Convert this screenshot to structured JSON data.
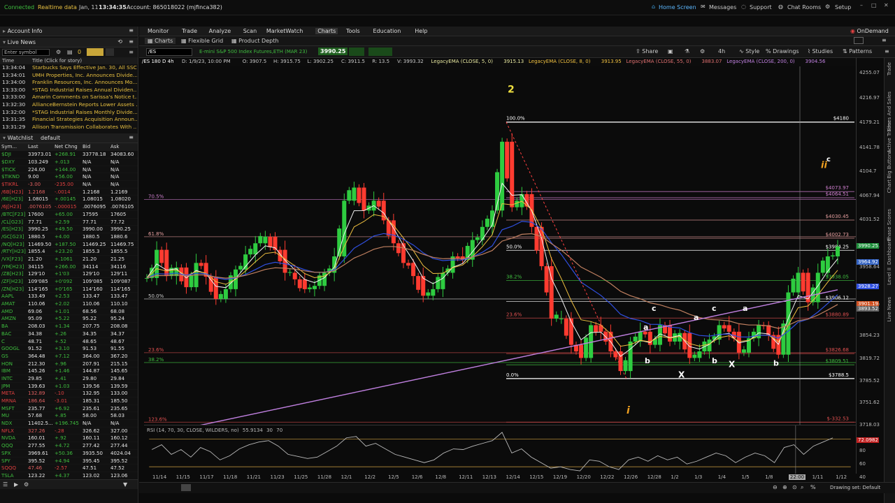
{
  "status": {
    "connected": "Connected",
    "realtime": "Realtime data",
    "date": "Jan, 11",
    "time": "13:34:35",
    "account": "Account: 865018022 (mjfinca382)",
    "home": "Home Screen",
    "messages": "Messages",
    "support": "Support",
    "chat": "Chat Rooms",
    "setup": "Setup"
  },
  "left": {
    "account_info": "Account Info",
    "live_news": "Live News",
    "enter_symbol": "Enter symbol",
    "count": "0",
    "news_header_time": "Time",
    "news_header_title": "Title (Click for story)",
    "news": [
      {
        "time": "13:34:04",
        "title": "Starbucks Says Effective Jan. 30, All SSC ..."
      },
      {
        "time": "13:34:01",
        "title": "UMH Properties, Inc. Announces Divide..."
      },
      {
        "time": "13:34:00",
        "title": "Franklin Resources, Inc. Announces Mo..."
      },
      {
        "time": "13:33:00",
        "title": "*STAG Industrial Raises Annual Dividen..."
      },
      {
        "time": "13:33:00",
        "title": "Amarin Comments on Sarissa's Notice t..."
      },
      {
        "time": "13:32:30",
        "title": "AllianceBernstein Reports Lower Assets ..."
      },
      {
        "time": "13:32:00",
        "title": "*STAG Industrial Raises Monthly Divide..."
      },
      {
        "time": "13:31:35",
        "title": "Financial Strategies Acquisition Announ..."
      },
      {
        "time": "13:31:29",
        "title": "Allison Transmission Collaborates With ..."
      }
    ],
    "watchlist_label": "Watchlist",
    "watchlist_name": "default",
    "cols": [
      "Sym...",
      "Last",
      "Net Chng",
      "Bid",
      "Ask"
    ],
    "rows": [
      [
        "$DJI",
        "33973.01",
        "+268.91",
        "33778.18",
        "34083.60"
      ],
      [
        "$DXY",
        "103.249",
        "+.013",
        "N/A",
        "N/A"
      ],
      [
        "$TICK",
        "224.00",
        "+144.00",
        "N/A",
        "N/A"
      ],
      [
        "$TIKND",
        "9.00",
        "+56.00",
        "N/A",
        "N/A"
      ],
      [
        "$TIKRL",
        "-3.00",
        "-235.00",
        "N/A",
        "N/A"
      ],
      [
        "/6B[H23]",
        "1.2168",
        "-.0014",
        "1.2168",
        "1.2169"
      ],
      [
        "/6E[H23]",
        "1.08015",
        "+.00145",
        "1.08015",
        "1.08020"
      ],
      [
        "/6J[H23]",
        ".0076105",
        "-.000015",
        ".0076095",
        ".0076105"
      ],
      [
        "/BTC[F23]",
        "17600",
        "+65.00",
        "17595",
        "17605"
      ],
      [
        "/CL[G23]",
        "77.71",
        "+2.59",
        "77.71",
        "77.72"
      ],
      [
        "/ES[H23]",
        "3990.25",
        "+49.50",
        "3990.00",
        "3990.25"
      ],
      [
        "/GC[G23]",
        "1880.5",
        "+4.00",
        "1880.5",
        "1880.6"
      ],
      [
        "/NQ[H23]",
        "11469.50",
        "+187.50",
        "11469.25",
        "11469.75"
      ],
      [
        "/RTY[H23]",
        "1855.4",
        "+23.20",
        "1855.3",
        "1855.5"
      ],
      [
        "/VX[F23]",
        "21.20",
        "+.1061",
        "21.20",
        "21.25"
      ],
      [
        "/YM[H23]",
        "34115",
        "+266.00",
        "34114",
        "34116"
      ],
      [
        "/ZB[H23]",
        "129'10",
        "+1'03",
        "129'10",
        "129'11"
      ],
      [
        "/ZF[H23]",
        "109'085",
        "+0'092",
        "109'085",
        "109'087"
      ],
      [
        "/ZN[H23]",
        "114'165",
        "+0'165",
        "114'160",
        "114'165"
      ],
      [
        "AAPL",
        "133.49",
        "+2.53",
        "133.47",
        "133.47"
      ],
      [
        "AMAT",
        "110.06",
        "+2.02",
        "110.06",
        "110.10"
      ],
      [
        "AMD",
        "69.06",
        "+1.01",
        "68.56",
        "68.08"
      ],
      [
        "AMZN",
        "95.09",
        "+5.22",
        "95.22",
        "95.24"
      ],
      [
        "BA",
        "208.03",
        "+1.34",
        "207.75",
        "208.08"
      ],
      [
        "BAC",
        "34.38",
        "+.26",
        "34.35",
        "34.37"
      ],
      [
        "C",
        "48.71",
        "+.52",
        "48.65",
        "48.67"
      ],
      [
        "GOOGL",
        "91.52",
        "+3.10",
        "91.53",
        "91.55"
      ],
      [
        "GS",
        "364.48",
        "+7.12",
        "364.00",
        "367.20"
      ],
      [
        "HON",
        "212.30",
        "+.96",
        "207.91",
        "215.15"
      ],
      [
        "IBM",
        "145.26",
        "+1.46",
        "144.87",
        "145.65"
      ],
      [
        "INTC",
        "29.85",
        "+.41",
        "29.80",
        "29.84"
      ],
      [
        "JPM",
        "139.63",
        "+1.03",
        "139.56",
        "139.59"
      ],
      [
        "META",
        "132.89",
        "-.10",
        "132.95",
        "133.00"
      ],
      [
        "MRNA",
        "186.64",
        "-3.01",
        "185.31",
        "185.50"
      ],
      [
        "MSFT",
        "235.77",
        "+6.92",
        "235.61",
        "235.65"
      ],
      [
        "MU",
        "57.68",
        "+.85",
        "58.00",
        "58.03"
      ],
      [
        "NDX",
        "11402.5...",
        "+196.745",
        "N/A",
        "N/A"
      ],
      [
        "NFLX",
        "327.26",
        "-.28",
        "326.62",
        "327.00"
      ],
      [
        "NVDA",
        "160.01",
        "+.92",
        "160.11",
        "160.12"
      ],
      [
        "QQQ",
        "277.55",
        "+4.72",
        "277.42",
        "277.44"
      ],
      [
        "SPX",
        "3969.61",
        "+50.36",
        "3935.50",
        "4024.04"
      ],
      [
        "SPY",
        "395.52",
        "+4.94",
        "395.45",
        "395.52"
      ],
      [
        "SQQQ",
        "47.46",
        "-2.57",
        "47.51",
        "47.52"
      ],
      [
        "TSLA",
        "123.22",
        "+4.37",
        "123.02",
        "123.06"
      ]
    ]
  },
  "menu": [
    "Monitor",
    "Trade",
    "Analyze",
    "Scan",
    "MarketWatch",
    "Charts",
    "Tools",
    "Education",
    "Help"
  ],
  "ondemand": "OnDemand",
  "subtabs": [
    "Charts",
    "Flexible Grid",
    "Product Depth"
  ],
  "chartbar": {
    "symbol": "/ES",
    "desc": "E-mini S&P 500 Index Futures,ETH (MAR 23)",
    "price": "3990.25",
    "tools": [
      "Share",
      "4h",
      "Style",
      "Drawings",
      "Studies",
      "Patterns"
    ]
  },
  "studybar": [
    {
      "text": "/ES 180 D 4h",
      "color": "#ffffff"
    },
    {
      "text": "D: 1/9/23, 10:00 PM",
      "color": "#c8c8c8"
    },
    {
      "text": "O: 3907.5",
      "color": "#c8c8c8"
    },
    {
      "text": "H: 3915.75",
      "color": "#c8c8c8"
    },
    {
      "text": "L: 3902.25",
      "color": "#c8c8c8"
    },
    {
      "text": "C: 3911.5",
      "color": "#c8c8c8"
    },
    {
      "text": "R: 13.5",
      "color": "#c8c8c8"
    },
    {
      "text": "V: 3993.32",
      "color": "#c8c8c8"
    },
    {
      "text": "LegacyEMA (CLOSE, 5, 0)",
      "color": "#e8e8a0"
    },
    {
      "text": "3915.13",
      "color": "#e8e8a0"
    },
    {
      "text": "LegacyEMA (CLOSE, 8, 0)",
      "color": "#f0c040"
    },
    {
      "text": "3913.95",
      "color": "#f0c040"
    },
    {
      "text": "LegacyEMA (CLOSE, 55, 0)",
      "color": "#e07070"
    },
    {
      "text": "3883.07",
      "color": "#e07070"
    },
    {
      "text": "LegacyEMA (CLOSE, 200, 0)",
      "color": "#c080e0"
    },
    {
      "text": "3904.56",
      "color": "#c080e0"
    }
  ],
  "chart_data": {
    "type": "candlestick",
    "symbol": "/ES",
    "ylim": [
      3718.03,
      4265
    ],
    "price_ticks": [
      "4255.07",
      "4216.97",
      "4179.21",
      "4141.78",
      "4104.7",
      "4067.94",
      "4031.52",
      "3990.25",
      "3958.64",
      "3928.27",
      "3901.19",
      "3893.52",
      "3854.23",
      "3819.72",
      "3785.52",
      "3751.62",
      "3718.03"
    ],
    "date_ticks": [
      "11/14",
      "11/15",
      "11/17",
      "11/18",
      "11/21",
      "11/23",
      "11/25",
      "11/28",
      "12/1",
      "12/2",
      "12/5",
      "12/6",
      "12/8",
      "12/11",
      "12/13",
      "12/14",
      "12/15",
      "12/19",
      "12/20",
      "12/22",
      "12/26",
      "12/28",
      "1/2",
      "1/3",
      "1/4",
      "1/5",
      "1/8",
      "22:00",
      "1/11",
      "1/12"
    ],
    "close_path": [
      3942,
      3985,
      3945,
      3958,
      3928,
      3965,
      3944,
      3910,
      3925,
      3955,
      3978,
      3995,
      4005,
      3985,
      3950,
      3940,
      3925,
      3930,
      3950,
      3975,
      4060,
      4080,
      4045,
      4060,
      4030,
      3995,
      3965,
      3945,
      3915,
      3925,
      3950,
      3975,
      3970,
      4000,
      4020,
      4045,
      4150,
      4050,
      4070,
      4020,
      3960,
      3880,
      3880,
      3840,
      3820,
      3870,
      3860,
      3830,
      3800,
      3845,
      3860,
      3840,
      3870,
      3845,
      3858,
      3820,
      3830,
      3848,
      3870,
      3860,
      3828,
      3850,
      3870,
      3855,
      3825,
      3920,
      3950,
      3905,
      3950,
      3975,
      3990
    ],
    "fib_left": [
      {
        "label": "70.5%",
        "price": 4062
      },
      {
        "label": "61.8%",
        "price": 4005
      },
      {
        "label": "50.0%",
        "price": 3910
      },
      {
        "label": "23.6%",
        "price": 3828
      },
      {
        "label": "38.2%",
        "price": 3813
      },
      {
        "label": "123.6%",
        "price": 3722
      }
    ],
    "fib_right": [
      {
        "label": "100.0%",
        "price": 4180,
        "value": "$4180"
      },
      {
        "label": "",
        "price": 4073.97,
        "value": "$4073.97"
      },
      {
        "label": "",
        "price": 4064.51,
        "value": "$4064.51"
      },
      {
        "label": "",
        "price": 4030.45,
        "value": "$4030.45"
      },
      {
        "label": "",
        "price": 4002.73,
        "value": "$4002.73"
      },
      {
        "label": "50.0%",
        "price": 3984.25,
        "value": "$3984.25"
      },
      {
        "label": "38.2%",
        "price": 3938.05,
        "value": "$3938.05"
      },
      {
        "label": "",
        "price": 3906.12,
        "value": "$3906.12"
      },
      {
        "label": "23.6%",
        "price": 3880.89,
        "value": "$3880.89"
      },
      {
        "label": "",
        "price": 3826.68,
        "value": "$3826.68"
      },
      {
        "label": "",
        "price": 3809.51,
        "value": "$3809.51"
      },
      {
        "label": "0.0%",
        "price": 3788.5,
        "value": "$3788.5"
      },
      {
        "label": "",
        "price": 3722,
        "value": "$-332.53"
      }
    ],
    "wave_labels": [
      "2",
      "i",
      "ii",
      "c",
      "a",
      "b",
      "c",
      "a",
      "b",
      "c",
      "a",
      "b",
      "X",
      "X"
    ],
    "price_tags": [
      "3990.25",
      "3964.92",
      "3928.27",
      "3901.19",
      "3893.52",
      "72.0982"
    ],
    "rsi_label": "RSI (14, 70, 30, CLOSE, WILDERS, no)",
    "rsi_value": "55.9134",
    "rsi_levels": [
      "30",
      "70"
    ],
    "rsi_ticks": [
      "80",
      "60",
      "40"
    ],
    "rsi_path": [
      55,
      62,
      48,
      55,
      44,
      58,
      52,
      40,
      46,
      56,
      62,
      66,
      68,
      60,
      48,
      45,
      42,
      44,
      52,
      60,
      72,
      74,
      60,
      64,
      56,
      48,
      44,
      40,
      36,
      40,
      50,
      56,
      55,
      60,
      64,
      68,
      80,
      50,
      56,
      44,
      36,
      28,
      30,
      26,
      24,
      40,
      38,
      30,
      26,
      40,
      44,
      38,
      46,
      40,
      44,
      34,
      38,
      44,
      50,
      46,
      36,
      44,
      50,
      46,
      36,
      58,
      62,
      48,
      60,
      66,
      72
    ]
  },
  "bottom": {
    "drawing_set": "Drawing set: Default"
  },
  "rail": [
    "Trade",
    "Times And Sales",
    "Active Trader",
    "Big Buttons",
    "Chart",
    "Phase Scores",
    "Dashboard",
    "Level II",
    "Live News"
  ]
}
